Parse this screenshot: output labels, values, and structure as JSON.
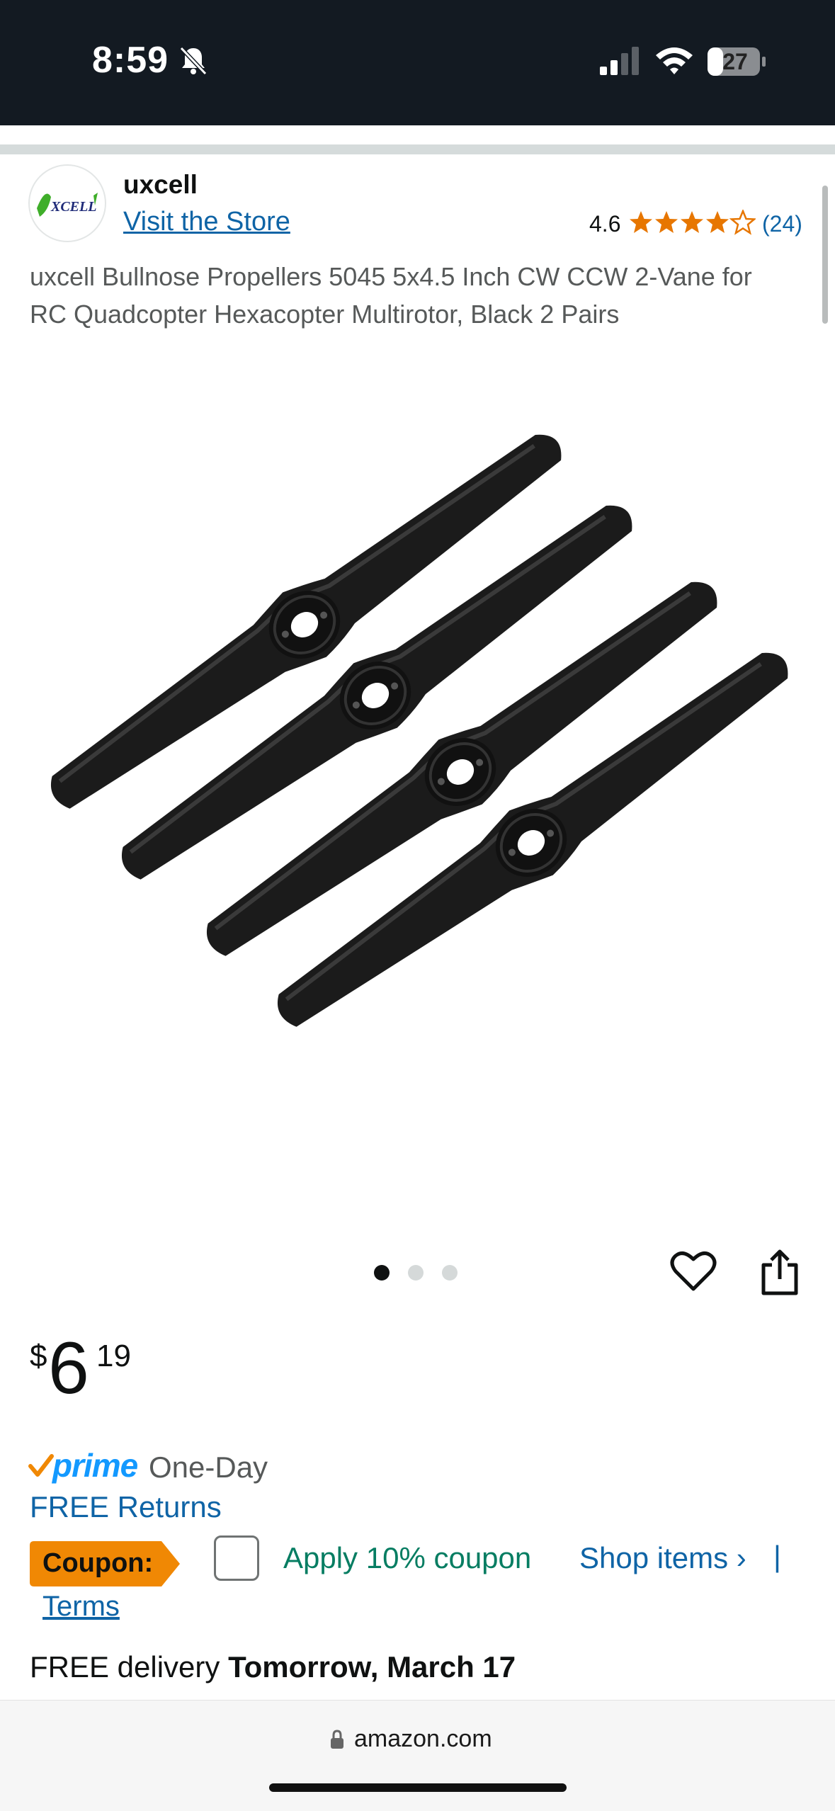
{
  "status_bar": {
    "time": "8:59",
    "battery": "27"
  },
  "brand": {
    "logo_text": "XCELL",
    "name": "uxcell",
    "store_link": "Visit the Store",
    "rating": "4.6",
    "review_count": "(24)",
    "star_color": "#e77600"
  },
  "product": {
    "title": "uxcell Bullnose Propellers 5045 5x4.5 Inch CW CCW 2-Vane for RC Quadcopter Hexacopter Multirotor, Black 2 Pairs",
    "image_icon": "propellers-image"
  },
  "gallery": {
    "dot_count": 3,
    "active_index": 0
  },
  "price": {
    "symbol": "$",
    "whole": "6",
    "fraction": "19"
  },
  "prime": {
    "label": "prime",
    "speed": "One-Day",
    "color": "#1399ff"
  },
  "returns": {
    "label": "FREE Returns"
  },
  "coupon": {
    "badge": "Coupon:",
    "apply_label": "Apply 10% coupon",
    "shop_items": "Shop items ›",
    "separator": "|",
    "terms": "Terms",
    "badge_color": "#f08804"
  },
  "delivery": {
    "prefix": "FREE delivery",
    "date": "Tomorrow, March 17"
  },
  "browser": {
    "url": "amazon.com"
  },
  "colors": {
    "link": "#0f64a6",
    "coupon_green": "#067d62",
    "header_bg": "#131a22"
  }
}
